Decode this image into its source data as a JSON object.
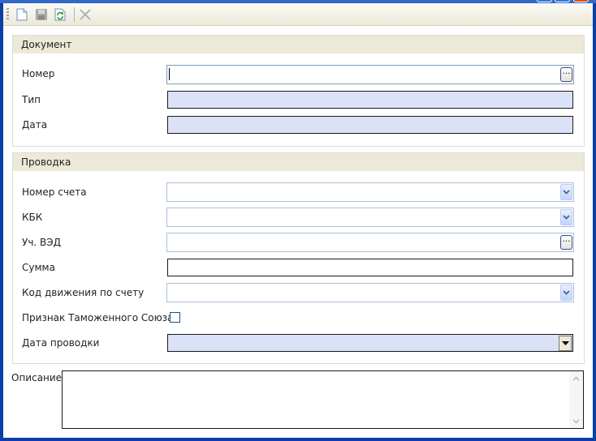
{
  "toolbar": {
    "buttons": [
      {
        "name": "new-document-icon",
        "enabled": true
      },
      {
        "name": "save-icon",
        "enabled": false
      },
      {
        "name": "refresh-icon",
        "enabled": true
      },
      {
        "name": "delete-icon",
        "enabled": false
      }
    ]
  },
  "document": {
    "header": "Документ",
    "number_label": "Номер",
    "number_value": "",
    "type_label": "Тип",
    "type_value": "",
    "date_label": "Дата",
    "date_value": ""
  },
  "posting": {
    "header": "Проводка",
    "account_label": "Номер счета",
    "account_value": "",
    "kbk_label": "КБК",
    "kbk_value": "",
    "ved_label": "Уч. ВЭД",
    "ved_value": "",
    "amount_label": "Сумма",
    "amount_value": "",
    "movement_label": "Код движения по счету",
    "movement_value": "",
    "customs_label": "Признак Таможенного Союза",
    "customs_checked": false,
    "posting_date_label": "Дата проводки",
    "posting_date_value": ""
  },
  "description": {
    "label": "Описание",
    "value": ""
  },
  "colors": {
    "group_header_bg": "#ece9d8",
    "required_field_bg": "#dbe2f7",
    "window_border": "#0a3fa8"
  }
}
